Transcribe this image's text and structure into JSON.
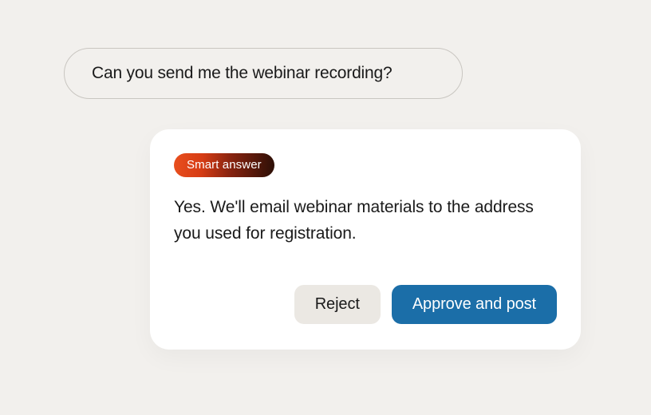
{
  "question": {
    "text": "Can you send me the webinar recording?"
  },
  "answer": {
    "badge": "Smart answer",
    "text": "Yes. We'll email webinar materials to the address you used for registration."
  },
  "actions": {
    "reject": "Reject",
    "approve": "Approve and post"
  }
}
